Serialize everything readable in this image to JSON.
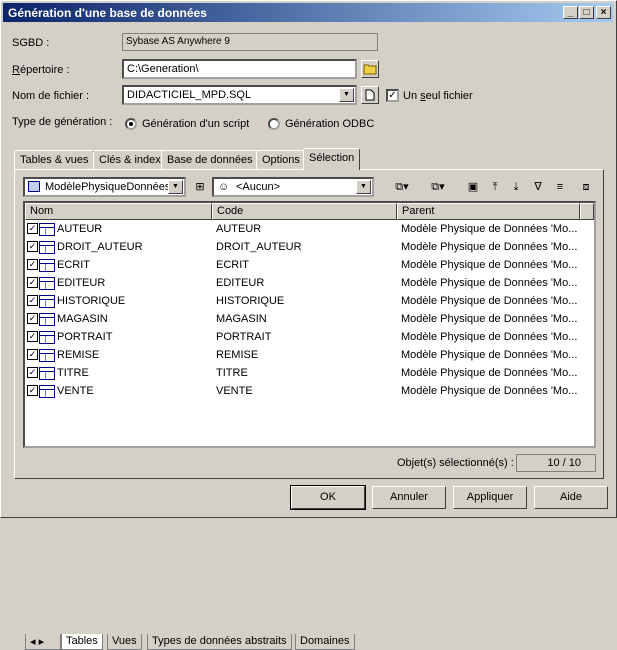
{
  "window": {
    "title": "Génération d'une base de données",
    "controls": [
      "_",
      "□",
      "×"
    ]
  },
  "form": {
    "sgbd_label": "SGBD :",
    "sgbd_value": "Sybase AS Anywhere 9",
    "repertoire_label_u": "R",
    "repertoire_label_rest": "épertoire :",
    "repertoire_value": "C:\\Generation\\",
    "fichier_label": "Nom de fichier :",
    "fichier_value": "DIDACTICIEL_MPD.SQL",
    "seul_fichier_pre": "Un ",
    "seul_fichier_u": "s",
    "seul_fichier_post": "eul fichier",
    "type_label": "Type de génération :",
    "radio_script": "Génération d'un script",
    "radio_odbc": "Génération ODBC"
  },
  "tabs": [
    "Tables & vues",
    "Clés & index",
    "Base de données",
    "Options",
    "Sélection"
  ],
  "selection": {
    "model_combo": "ModèlePhysiqueDonnées",
    "owner_combo": "<Aucun>",
    "columns": [
      "Nom",
      "Code",
      "Parent"
    ],
    "rows": [
      {
        "nom": "AUTEUR",
        "code": "AUTEUR",
        "parent": "Modèle Physique de Données 'Mo..."
      },
      {
        "nom": "DROIT_AUTEUR",
        "code": "DROIT_AUTEUR",
        "parent": "Modèle Physique de Données 'Mo..."
      },
      {
        "nom": "ECRIT",
        "code": "ECRIT",
        "parent": "Modèle Physique de Données 'Mo..."
      },
      {
        "nom": "EDITEUR",
        "code": "EDITEUR",
        "parent": "Modèle Physique de Données 'Mo..."
      },
      {
        "nom": "HISTORIQUE",
        "code": "HISTORIQUE",
        "parent": "Modèle Physique de Données 'Mo..."
      },
      {
        "nom": "MAGASIN",
        "code": "MAGASIN",
        "parent": "Modèle Physique de Données 'Mo..."
      },
      {
        "nom": "PORTRAIT",
        "code": "PORTRAIT",
        "parent": "Modèle Physique de Données 'Mo..."
      },
      {
        "nom": "REMISE",
        "code": "REMISE",
        "parent": "Modèle Physique de Données 'Mo..."
      },
      {
        "nom": "TITRE",
        "code": "TITRE",
        "parent": "Modèle Physique de Données 'Mo..."
      },
      {
        "nom": "VENTE",
        "code": "VENTE",
        "parent": "Modèle Physique de Données 'Mo..."
      }
    ],
    "subtabs": [
      "Tables",
      "Vues",
      "Types de données abstraits",
      "Domaines"
    ],
    "count_label": "Objet(s) sélectionné(s) :",
    "count_value": "10 / 10"
  },
  "buttons": {
    "ok": "OK",
    "annuler": "Annuler",
    "appliquer": "Appliquer",
    "aide": "Aide"
  },
  "icons": {
    "folder": "folder-icon",
    "file": "file-icon",
    "model": "model-icon",
    "owner": "owner-icon",
    "toolbar": [
      "select-all-icon",
      "deselect-all-icon",
      "check-icon",
      "move-top-icon",
      "move-bottom-icon",
      "filter-icon",
      "sort-icon",
      "properties-icon"
    ]
  },
  "colors": {
    "titlebar_start": "#0a246a",
    "titlebar_end": "#a6caf0",
    "face": "#d4d0c8"
  }
}
